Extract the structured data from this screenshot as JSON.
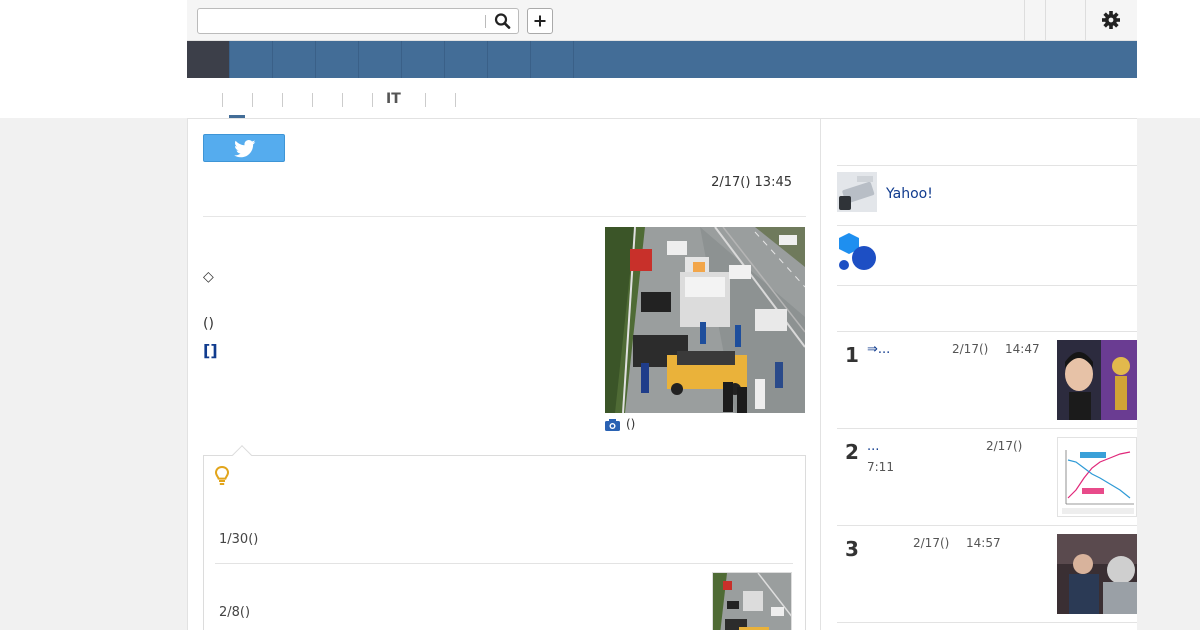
{
  "header": {
    "search_placeholder": "",
    "search_icon": "search-icon",
    "add_icon": "plus-icon",
    "settings_icon": "gear-icon"
  },
  "nav": {
    "active_color": "#3c3f49",
    "bar_color": "#436d97",
    "items": [
      "",
      "",
      "",
      "",
      "",
      "",
      "",
      "",
      ""
    ]
  },
  "subnav": {
    "items": [
      "",
      "",
      "",
      "",
      "",
      "IT",
      ""
    ]
  },
  "article": {
    "tweet_icon": "twitter-bird-icon",
    "date": "2/17() 13:45",
    "diamond": "◇",
    "paren": "()",
    "bracket_link": "[]",
    "photo_caption": "()",
    "camera_icon": "camera-icon"
  },
  "related": {
    "bulb_icon": "lightbulb-icon",
    "items": [
      {
        "date": "1/30()"
      },
      {
        "date": "2/8()"
      }
    ]
  },
  "sidebar": {
    "yahoo_label": "Yahoo!",
    "ranking": [
      {
        "rank": "1",
        "title": "⇒...",
        "date": "2/17()",
        "time": "14:47"
      },
      {
        "rank": "2",
        "title": "...",
        "date": "2/17()",
        "time": "7:11"
      },
      {
        "rank": "3",
        "title": "",
        "date": "2/17()",
        "time": "14:57"
      }
    ]
  }
}
